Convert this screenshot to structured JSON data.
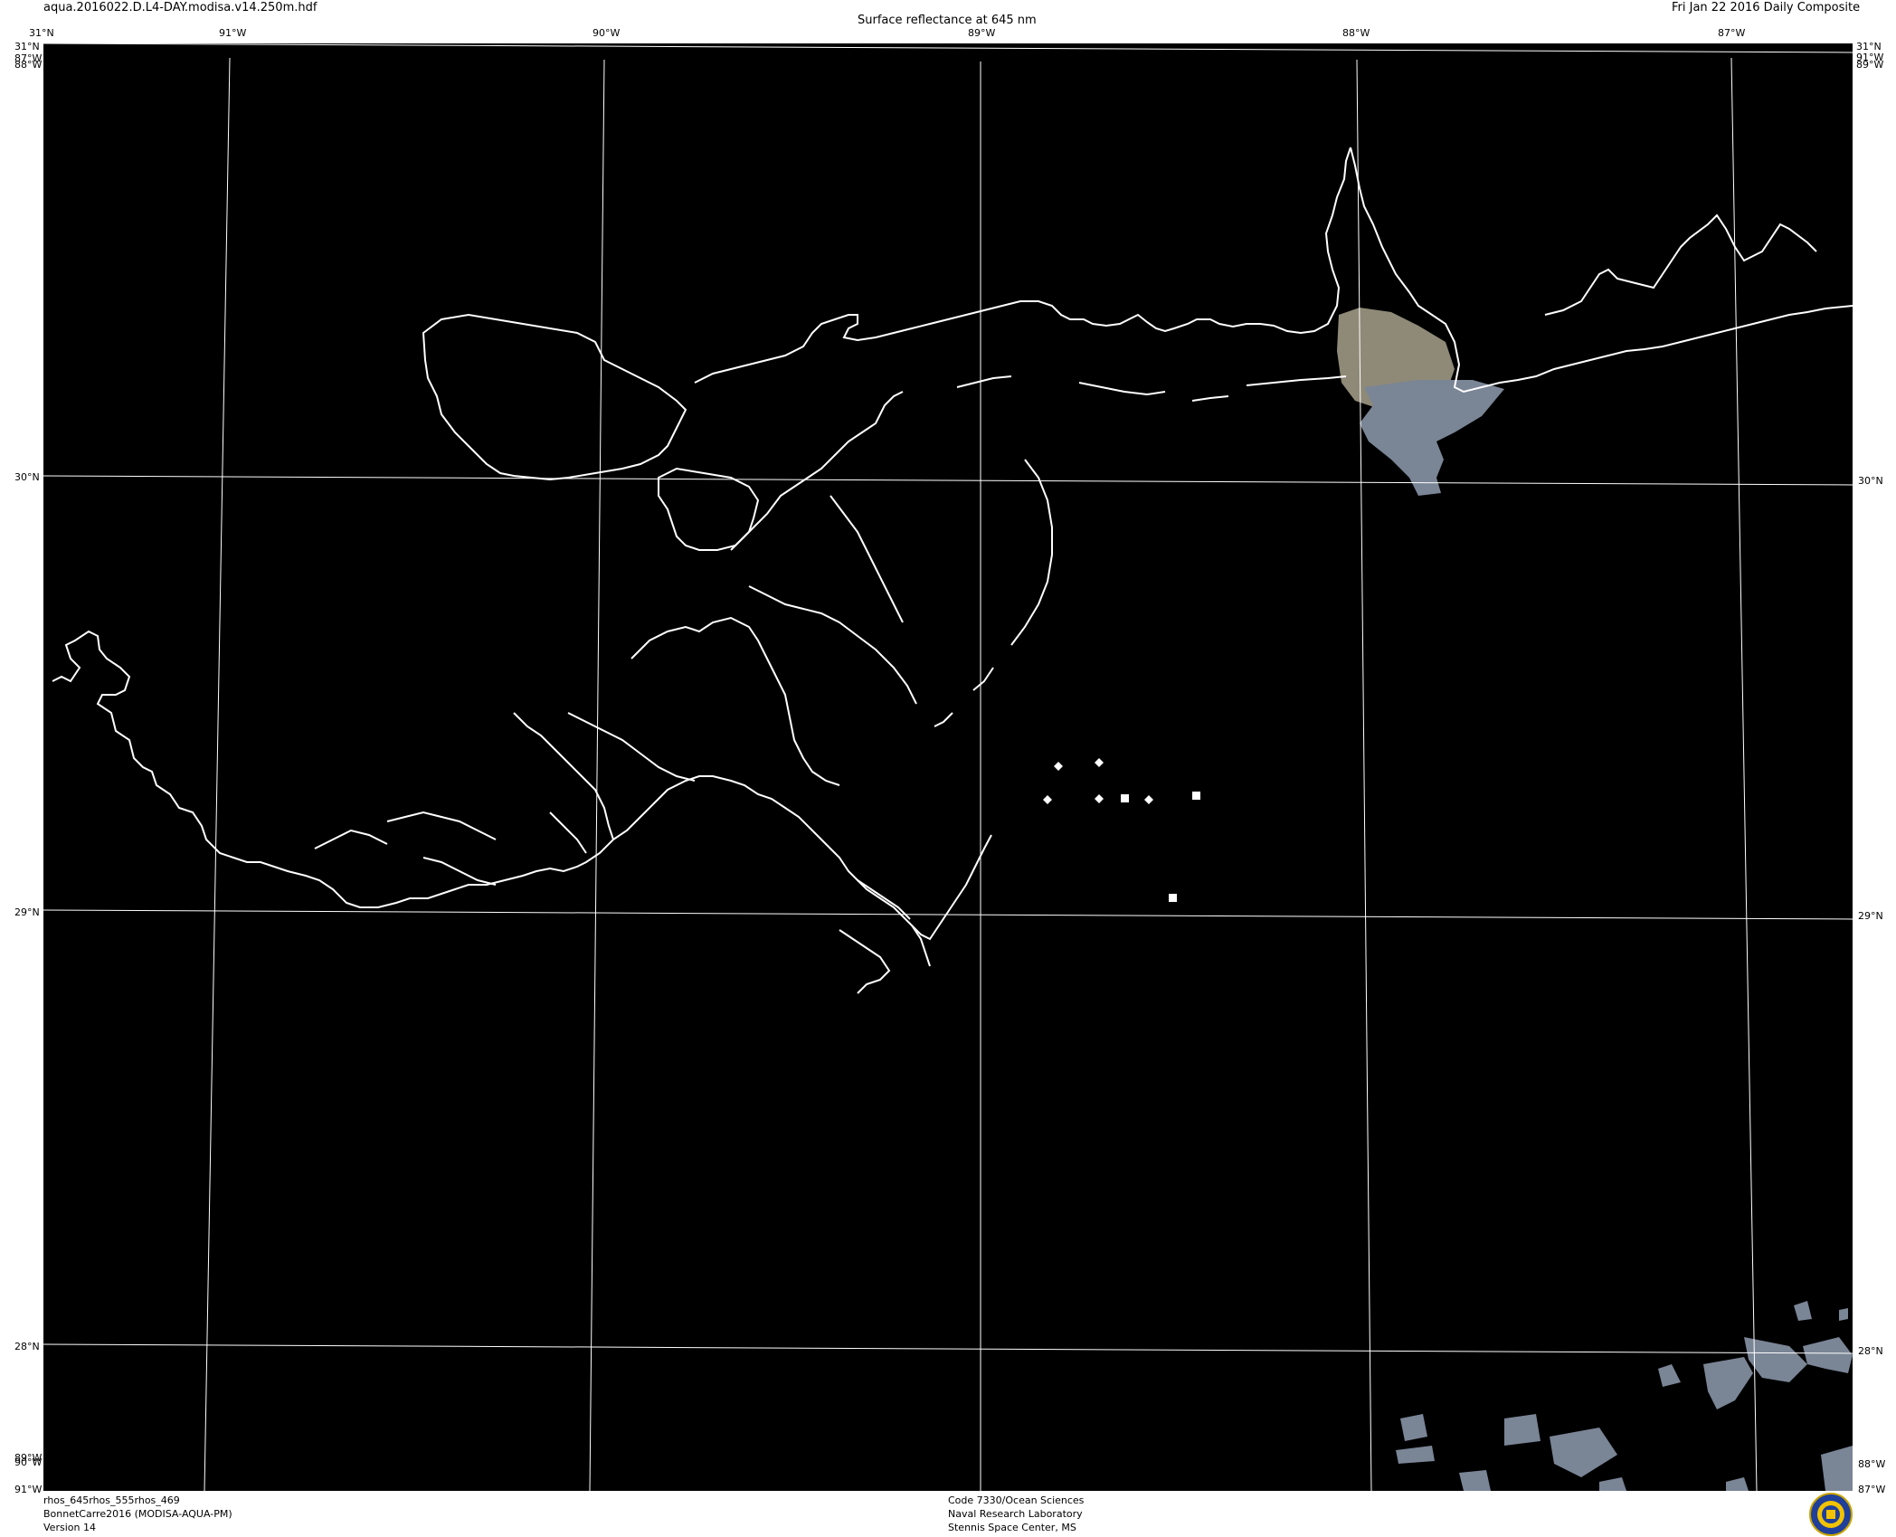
{
  "header": {
    "filename": "aqua.2016022.D.L4-DAY.modisa.v14.250m.hdf",
    "product_title": "Surface reflectance at 645 nm",
    "date_label": "Fri Jan 22 2016 Daily Composite"
  },
  "footer": {
    "left_lines": [
      "rhos_645rhos_555rhos_469",
      "BonnetCarre2016 (MODISA-AQUA-PM)",
      "Version 14"
    ],
    "center_lines": [
      "Code 7330/Ocean Sciences",
      "Naval Research Laboratory",
      "Stennis Space Center, MS"
    ]
  },
  "map": {
    "background_color": "#000000",
    "graticule_color": "#ffffff",
    "coastline_color": "#ffffff",
    "plume_color": "#8f8a78",
    "cloud_color": "#7a8596",
    "lon_labels": [
      "91°W",
      "90°W",
      "89°W",
      "88°W",
      "87°W"
    ],
    "lat_labels": [
      "31°N",
      "30°N",
      "29°N",
      "28°N"
    ],
    "corner_labels": {
      "top_left": [
        "31°N",
        "87°W",
        "88°W"
      ],
      "top_right": [
        "31°N",
        "91°W",
        "89°W"
      ],
      "bottom_left": [
        "89°W",
        "90°W",
        "91°W"
      ],
      "bottom_right": [
        "88°W",
        "87°W"
      ]
    }
  },
  "logo": {
    "icon": "nrl-seal-icon"
  }
}
